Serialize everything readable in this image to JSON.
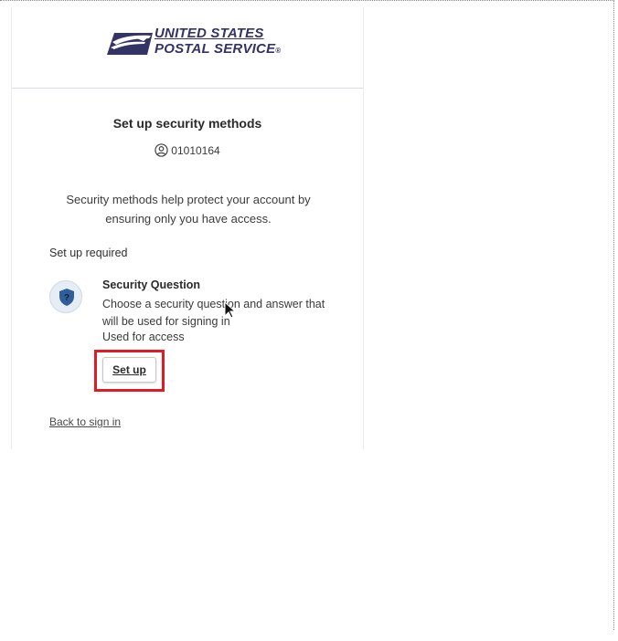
{
  "header": {
    "logo_line1": "UNITED STATES",
    "logo_line2": "POSTAL SERVICE",
    "logo_reg": "®"
  },
  "main": {
    "title": "Set up security methods",
    "user_icon": "user-circle-icon",
    "username": "01010164",
    "description": "Security methods help protect your account by ensuring only you have access.",
    "section_label": "Set up required",
    "method": {
      "icon": "shield-question-icon",
      "title": "Security Question",
      "description": "Choose a security question and answer that will be used for signing in",
      "usage": "Used for access",
      "button_label": "Set up"
    },
    "back_link": "Back to sign in"
  },
  "colors": {
    "brand_navy": "#333366",
    "highlight_red": "#e01b24",
    "shield_blue": "#2f5f98"
  }
}
